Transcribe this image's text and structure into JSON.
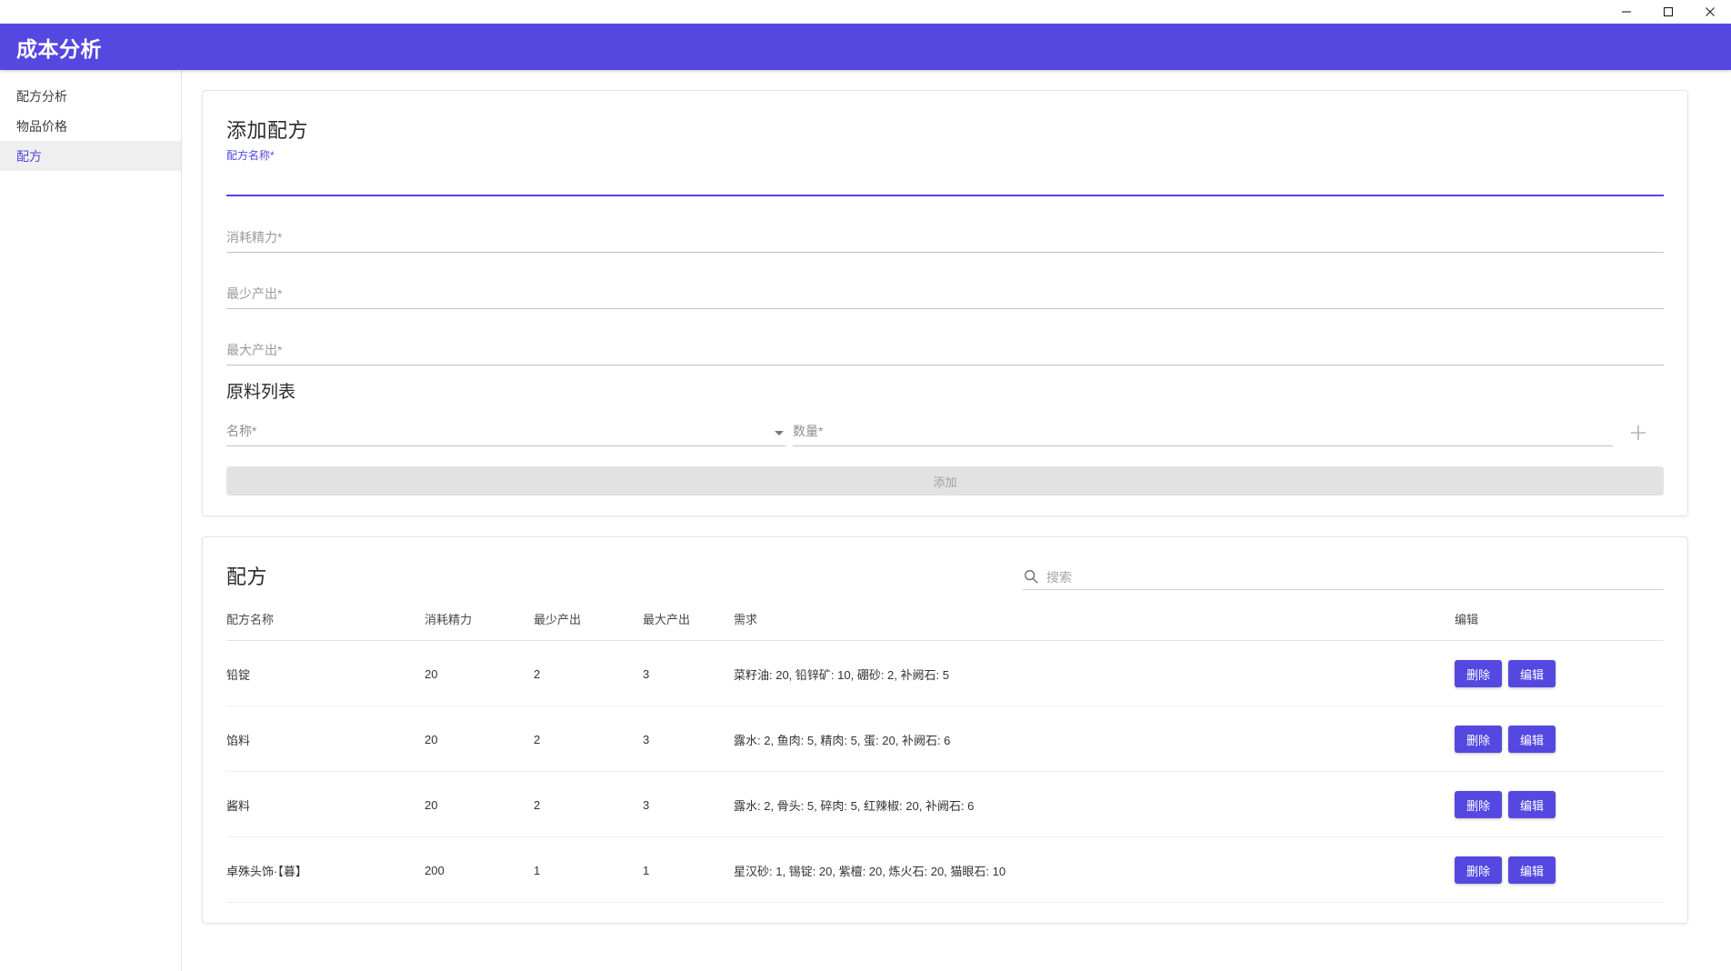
{
  "window": {
    "minimize_label": "minimize",
    "maximize_label": "maximize",
    "close_label": "close"
  },
  "header": {
    "title": "成本分析",
    "accent_color": "#5448e0"
  },
  "sidebar": {
    "items": [
      {
        "label": "配方分析",
        "active": false
      },
      {
        "label": "物品价格",
        "active": false
      },
      {
        "label": "配方",
        "active": true
      }
    ]
  },
  "add_form": {
    "title": "添加配方",
    "fields": [
      {
        "label": "配方名称*",
        "value": "",
        "focused": true
      },
      {
        "label": "消耗精力*",
        "value": "",
        "focused": false
      },
      {
        "label": "最少产出*",
        "value": "",
        "focused": false
      },
      {
        "label": "最大产出*",
        "value": "",
        "focused": false
      }
    ],
    "ingredients_title": "原料列表",
    "ingredient_name_placeholder": "名称*",
    "ingredient_qty_placeholder": "数量*",
    "add_row_icon": "plus-icon",
    "submit_label": "添加"
  },
  "recipes": {
    "title": "配方",
    "search_placeholder": "搜索",
    "search_value": "",
    "search_icon": "search-icon",
    "columns": [
      "配方名称",
      "消耗精力",
      "最少产出",
      "最大产出",
      "需求",
      "编辑"
    ],
    "row_actions": {
      "delete_label": "删除",
      "edit_label": "编辑"
    },
    "rows": [
      {
        "name": "铅锭",
        "stamina": "20",
        "min_output": "2",
        "max_output": "3",
        "requirements": "菜籽油: 20, 铅锌矿: 10, 硼砂: 2, 补阙石: 5"
      },
      {
        "name": "馅料",
        "stamina": "20",
        "min_output": "2",
        "max_output": "3",
        "requirements": "露水: 2, 鱼肉: 5, 精肉: 5, 蛋: 20, 补阙石: 6"
      },
      {
        "name": "酱料",
        "stamina": "20",
        "min_output": "2",
        "max_output": "3",
        "requirements": "露水: 2, 骨头: 5, 碎肉: 5, 红辣椒: 20, 补阙石: 6"
      },
      {
        "name": "卓殊头饰·【暮】",
        "stamina": "200",
        "min_output": "1",
        "max_output": "1",
        "requirements": "星汉砂: 1, 锡锭: 20, 紫檀: 20, 炼火石: 20, 猫眼石: 10"
      }
    ]
  }
}
